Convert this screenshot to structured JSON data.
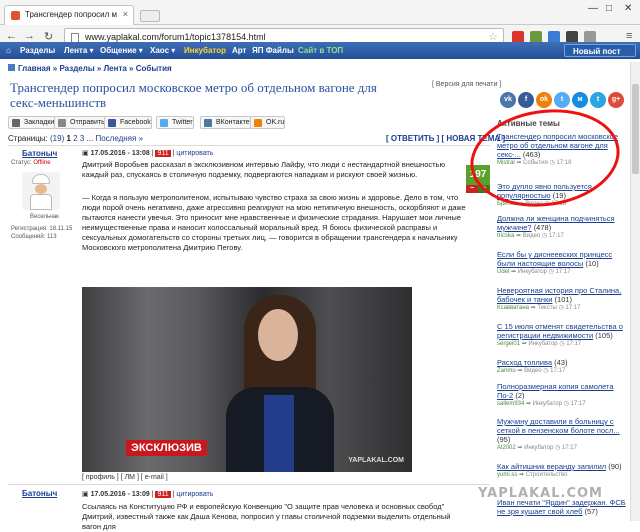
{
  "browser": {
    "tab_title": "Трансгендер попросил м",
    "url": "www.yaplakal.com/forum1/topic1378154.html"
  },
  "sitenav": {
    "items": [
      "Разделы",
      "Лента ▾",
      "Общение ▾",
      "Хаос ▾",
      "Инкубатор",
      "Арт",
      "ЯП Файлы",
      "Сайт в ТОП"
    ],
    "new_post": "Новый пост"
  },
  "breadcrumb": [
    "Главная",
    "Разделы",
    "Лента",
    "События"
  ],
  "topic": {
    "title": "Трансгендер попросил московское метро об отдельном вагоне для секс-меньшинств",
    "print_version": "[ Версия для печати ]"
  },
  "share": {
    "buttons": [
      "Закладки",
      "Отправить",
      "Facebook",
      "Twitter",
      "ВКонтакте",
      "OK.ru"
    ],
    "colors": [
      "#666666",
      "#888888",
      "#3b5998",
      "#55acee",
      "#4a76a8",
      "#ee8208"
    ]
  },
  "pager": {
    "label": "Страницы:",
    "count": "(19)",
    "pages": [
      "1",
      "2",
      "3"
    ],
    "dots": "...",
    "last": "Последняя »",
    "reply": "[ ОТВЕТИТЬ ]",
    "new_topic": "[ НОВАЯ ТЕМА ]"
  },
  "post1": {
    "author": "Батоныч",
    "date": "17.05.2016 - 13:08",
    "num": "911",
    "quote": "цитировать",
    "status_label": "Статус:",
    "status": "Offline",
    "rank": "Весельчак",
    "reg": "Регистрация: 18.11.15",
    "msgs": "Сообщений: 113",
    "rating": "197",
    "minus": "−",
    "plus": "+",
    "p1": "Дмитрий Воробьев рассказал в эксклюзивном интервью Лайфу, что люди с нестандартной внешностью каждый раз, спускаясь в столичную подземку, подвергаются нападкам и рискуют своей жизнью.",
    "p2": "— Когда я пользую метрополитеном, испытываю чувство страха за свою жизнь и здоровье. Дело в том, что люди порой очень негативно, даже агрессивно реагируют на мою нетипичную внешность, оскорбляют и даже пытаются нанести увечья. Это приносит мне нравственные и физические страдания. Нарушает мои личные неимущественные права и наносит колоссальный моральный вред. Я боюсь физической расправы и сексуальных домогательств со стороны третьих лиц, — говорится в обращении трансгендера к начальнику Московского метрополитена Дмитрию Пегову.",
    "photo_tag": "ЭКСКЛЮЗИВ",
    "photo_wm": "YAPLAKAL.COM",
    "links": "[ профиль ]  [ ЛМ ]  [ e-mail ]"
  },
  "post2": {
    "author": "Батоныч",
    "date": "17.05.2016 - 13:09",
    "num": "911",
    "quote": "цитировать",
    "text": "Ссылаясь на Конституцию РФ и европейскую Конвенцию \"О защите прав человека и основных свобод\" Дмитрий, известный также как Даша Кенова, попросил у главы столичной подземки выделить отдельный вагон для"
  },
  "sidebar": {
    "social": [
      "vk",
      "f",
      "ok",
      "t",
      "м",
      "t",
      "g+"
    ],
    "social_colors": [
      "#4a76a8",
      "#3b5998",
      "#ee8208",
      "#55acee",
      "#168de2",
      "#2ca5e0",
      "#dd4b39"
    ],
    "active_title": "Активные темы",
    "topics": [
      {
        "t": "Трансгендер попросил московское метро об отдельном вагоне для секс-...",
        "c": "(463)",
        "u": "Mistral",
        "s": "События",
        "time": "17:18"
      },
      {
        "t": "Это дупло явно пользуется популярностью",
        "c": "(19)",
        "u": "Бритва",
        "s": "Видео",
        "time": "17:18"
      },
      {
        "t": "Должна ли женщина подчиняться мужчине?",
        "c": "(478)",
        "u": "tricska",
        "s": "Видео",
        "time": "17:17"
      },
      {
        "t": "Если бы у диснеевских принцесс были настоящие волосы",
        "c": "(10)",
        "u": "Udel",
        "s": "Инкубатор",
        "time": "17:17"
      },
      {
        "t": "Невероятная история про Сталина, бабочек и танки",
        "c": "(101)",
        "u": "Ксавватана",
        "s": "Тексты",
        "time": "17:17"
      },
      {
        "t": "С 15 июля отменят свидетельства о регистрации недвижимости",
        "c": "(105)",
        "u": "sergei01",
        "s": "Инкубатор",
        "time": "17:17"
      },
      {
        "t": "Расход топлива",
        "c": "(43)",
        "u": "Zanmu",
        "s": "Видео",
        "time": "17:17"
      },
      {
        "t": "Полноразмерная копия самолета По-2",
        "c": "(2)",
        "u": "sallem934",
        "s": "Инкубатор",
        "time": "17:17"
      },
      {
        "t": "Мужчину доставили в больницу с сеткой в пензенском болоте посл...",
        "c": "(95)",
        "u": "Al2002",
        "s": "Инкубатор",
        "time": "17:17"
      },
      {
        "t": "Как айтишник веранду запилил",
        "c": "(90)",
        "u": "yumi.ss",
        "s": "Строительство",
        "time": ""
      },
      {
        "t": "Иван печати \"Ярдин\" задержан. ФСБ не зря кушает свой хлеб",
        "c": "(57)",
        "u": "",
        "s": "",
        "time": ""
      }
    ]
  },
  "watermark": "YAPLAKAL.COM"
}
